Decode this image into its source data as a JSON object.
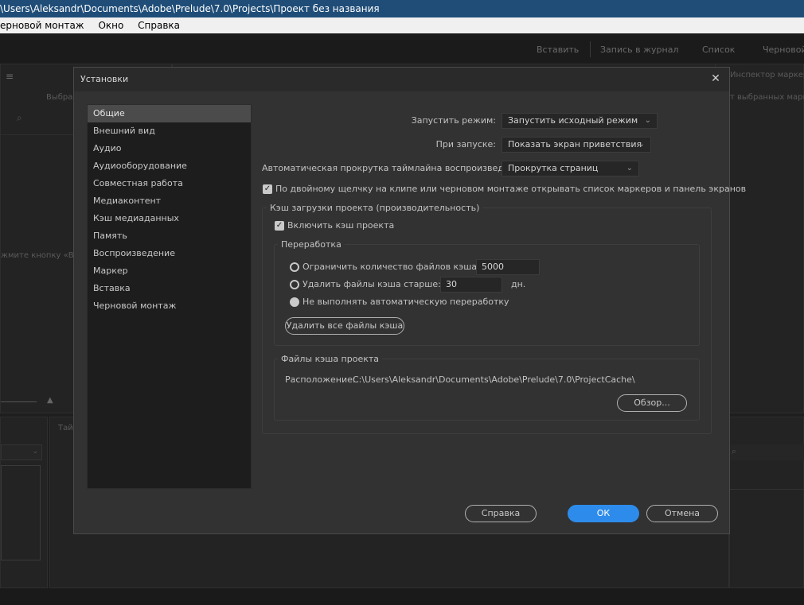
{
  "window": {
    "title": "\\Users\\Aleksandr\\Documents\\Adobe\\Prelude\\7.0\\Projects\\Проект без названия"
  },
  "menu": {
    "items": [
      "ерновой монтаж",
      "Окно",
      "Справка"
    ]
  },
  "workspace": {
    "tabs": [
      "Вставить",
      "Запись в журнал",
      "Список",
      "Черновой"
    ]
  },
  "background": {
    "left_label": "Выбран",
    "left_hint": "жмите кнопку «Вст",
    "right_title": "Инспектор маркеро",
    "right_sub": "т выбранных марк",
    "bottom_tab": "Тай"
  },
  "dialog": {
    "title": "Установки",
    "close_glyph": "✕",
    "categories": [
      "Общие",
      "Внешний вид",
      "Аудио",
      "Аудиооборудование",
      "Совместная работа",
      "Медиаконтент",
      "Кэш медиаданных",
      "Память",
      "Воспроизведение",
      "Маркер",
      "Вставка",
      "Черновой монтаж"
    ],
    "selected_category": "Общие",
    "launch_mode": {
      "label": "Запустить режим:",
      "value": "Запустить исходный режим"
    },
    "on_startup": {
      "label": "При запуске:",
      "value": "Показать экран приветствия"
    },
    "autoscroll": {
      "label": "Автоматическая прокрутка таймлайна воспроизведения:",
      "value": "Прокрутка страниц"
    },
    "dblclick": {
      "label": "По двойному щелчку на клипе или черновом монтаже открывать список маркеров и панель экранов",
      "checked": true
    },
    "cache_group": {
      "title": "Кэш загрузки проекта (производительность)",
      "enable": {
        "label": "Включить кэш проекта",
        "checked": true
      },
      "processing": {
        "title": "Переработка",
        "limit_files": {
          "label": "Ограничить количество файлов кэша до",
          "value": "5000"
        },
        "delete_older": {
          "label": "Удалить файлы кэша старше:",
          "value": "30",
          "unit": "дн."
        },
        "no_auto": {
          "label": "Не выполнять автоматическую переработку",
          "selected": true
        },
        "delete_all_button": "Удалить все файлы кэша"
      },
      "files": {
        "title": "Файлы кэша проекта",
        "location_label": "Расположение:",
        "location_value": "C:\\Users\\Aleksandr\\Documents\\Adobe\\Prelude\\7.0\\ProjectCache\\",
        "browse_button": "Обзор..."
      }
    },
    "buttons": {
      "help": "Справка",
      "ok": "ОК",
      "cancel": "Отмена"
    }
  },
  "colors": {
    "accent": "#2d8ceb",
    "titlebar": "#1f4d78",
    "dialog_bg": "#323232"
  }
}
